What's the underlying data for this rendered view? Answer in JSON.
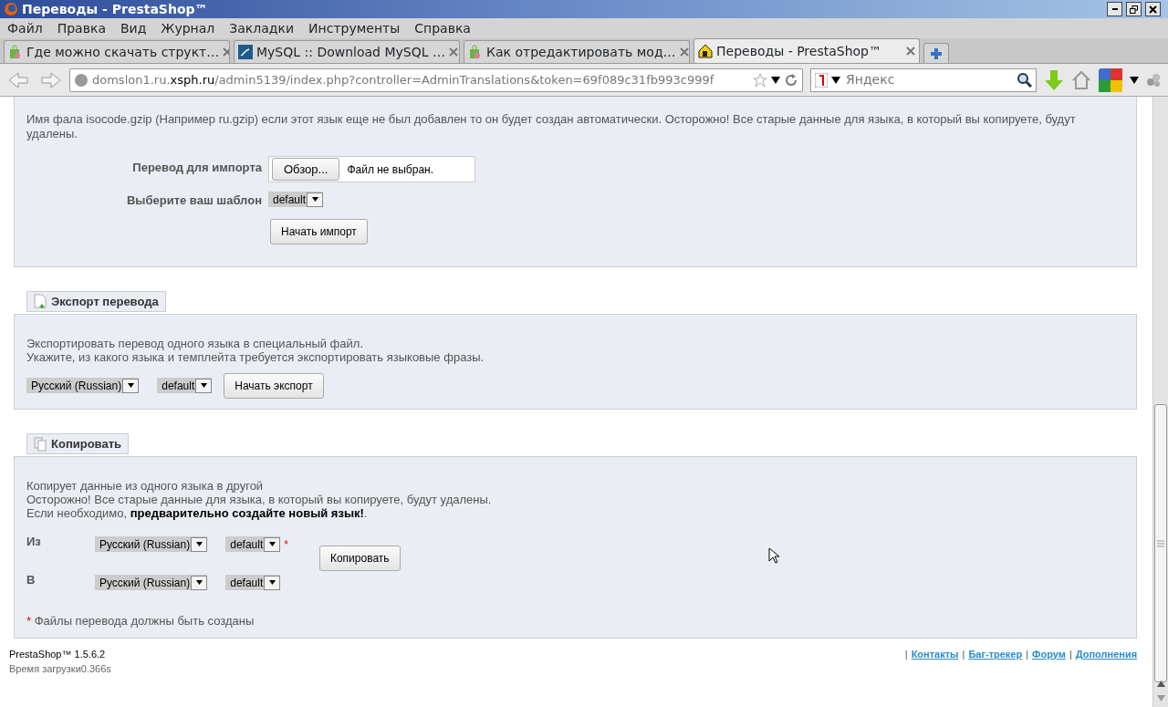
{
  "window": {
    "title": "Переводы - PrestaShop™"
  },
  "menu": [
    "Файл",
    "Правка",
    "Вид",
    "Журнал",
    "Закладки",
    "Инструменты",
    "Справка"
  ],
  "tabs": [
    {
      "label": "Где можно скачать структ…",
      "kind": "bag",
      "selected": false
    },
    {
      "label": "MySQL :: Download MySQL …",
      "kind": "mysql",
      "selected": false
    },
    {
      "label": "Как отредактировать мод…",
      "kind": "bag",
      "selected": false
    },
    {
      "label": "Переводы - PrestaShop™",
      "kind": "home",
      "selected": true
    }
  ],
  "address": {
    "segments": [
      {
        "text": "domslon1.ru.",
        "emphasis": false
      },
      {
        "text": "xsph.ru",
        "emphasis": true
      },
      {
        "text": "/admin5139/index.php?controller=AdminTranslations&token=69f089c31fb993c999f",
        "emphasis": false
      }
    ]
  },
  "search": {
    "placeholder": "Яндекс"
  },
  "import": {
    "note": "Имя фала isocode.gzip (Например ru.gzip) если этот язык еще не был добавлен то он будет создан автоматически. Осторожно! Все старые данные для языка, в который вы копируете, будут удалены.",
    "file_label": "Перевод для импорта",
    "browse": "Обзор...",
    "file_status": "Файл не выбран.",
    "template_label": "Выберите ваш шаблон",
    "template": "default",
    "submit": "Начать импорт"
  },
  "export": {
    "legend": "Экспорт перевода",
    "lines": [
      "Экспортировать перевод одного языка в специальный файл.",
      "Укажите, из какого языка и темплейта требуется экспортировать языковые фразы."
    ],
    "language": "Русский (Russian)",
    "template": "default",
    "submit": "Начать экспорт"
  },
  "copy": {
    "legend": "Копировать",
    "lines": [
      "Копирует данные из одного языка в другой",
      "Осторожно! Все старые данные для языка, в который вы копируете, будут удалены.",
      "Если необходимо, **предварительно создайте новый язык!**."
    ],
    "rows": [
      {
        "label": "Из",
        "language": "Русский (Russian)",
        "template": "default",
        "required": true
      },
      {
        "label": "В",
        "language": "Русский (Russian)",
        "template": "default",
        "required": false
      }
    ],
    "required_mark": "*",
    "submit": "Копировать",
    "footnote_mark": "*",
    "footnote": "Файлы перевода должны быть созданы"
  },
  "footer": {
    "version": "PrestaShop™ 1.5.6.2",
    "load_time": "Время загрузки0.366s",
    "links": [
      {
        "separator": "|",
        "label": "Контакты"
      },
      {
        "separator": "|",
        "label": "Баг-трекер"
      },
      {
        "separator": "|",
        "label": "Форум"
      },
      {
        "separator": "|",
        "label": "Дополнения"
      }
    ]
  }
}
